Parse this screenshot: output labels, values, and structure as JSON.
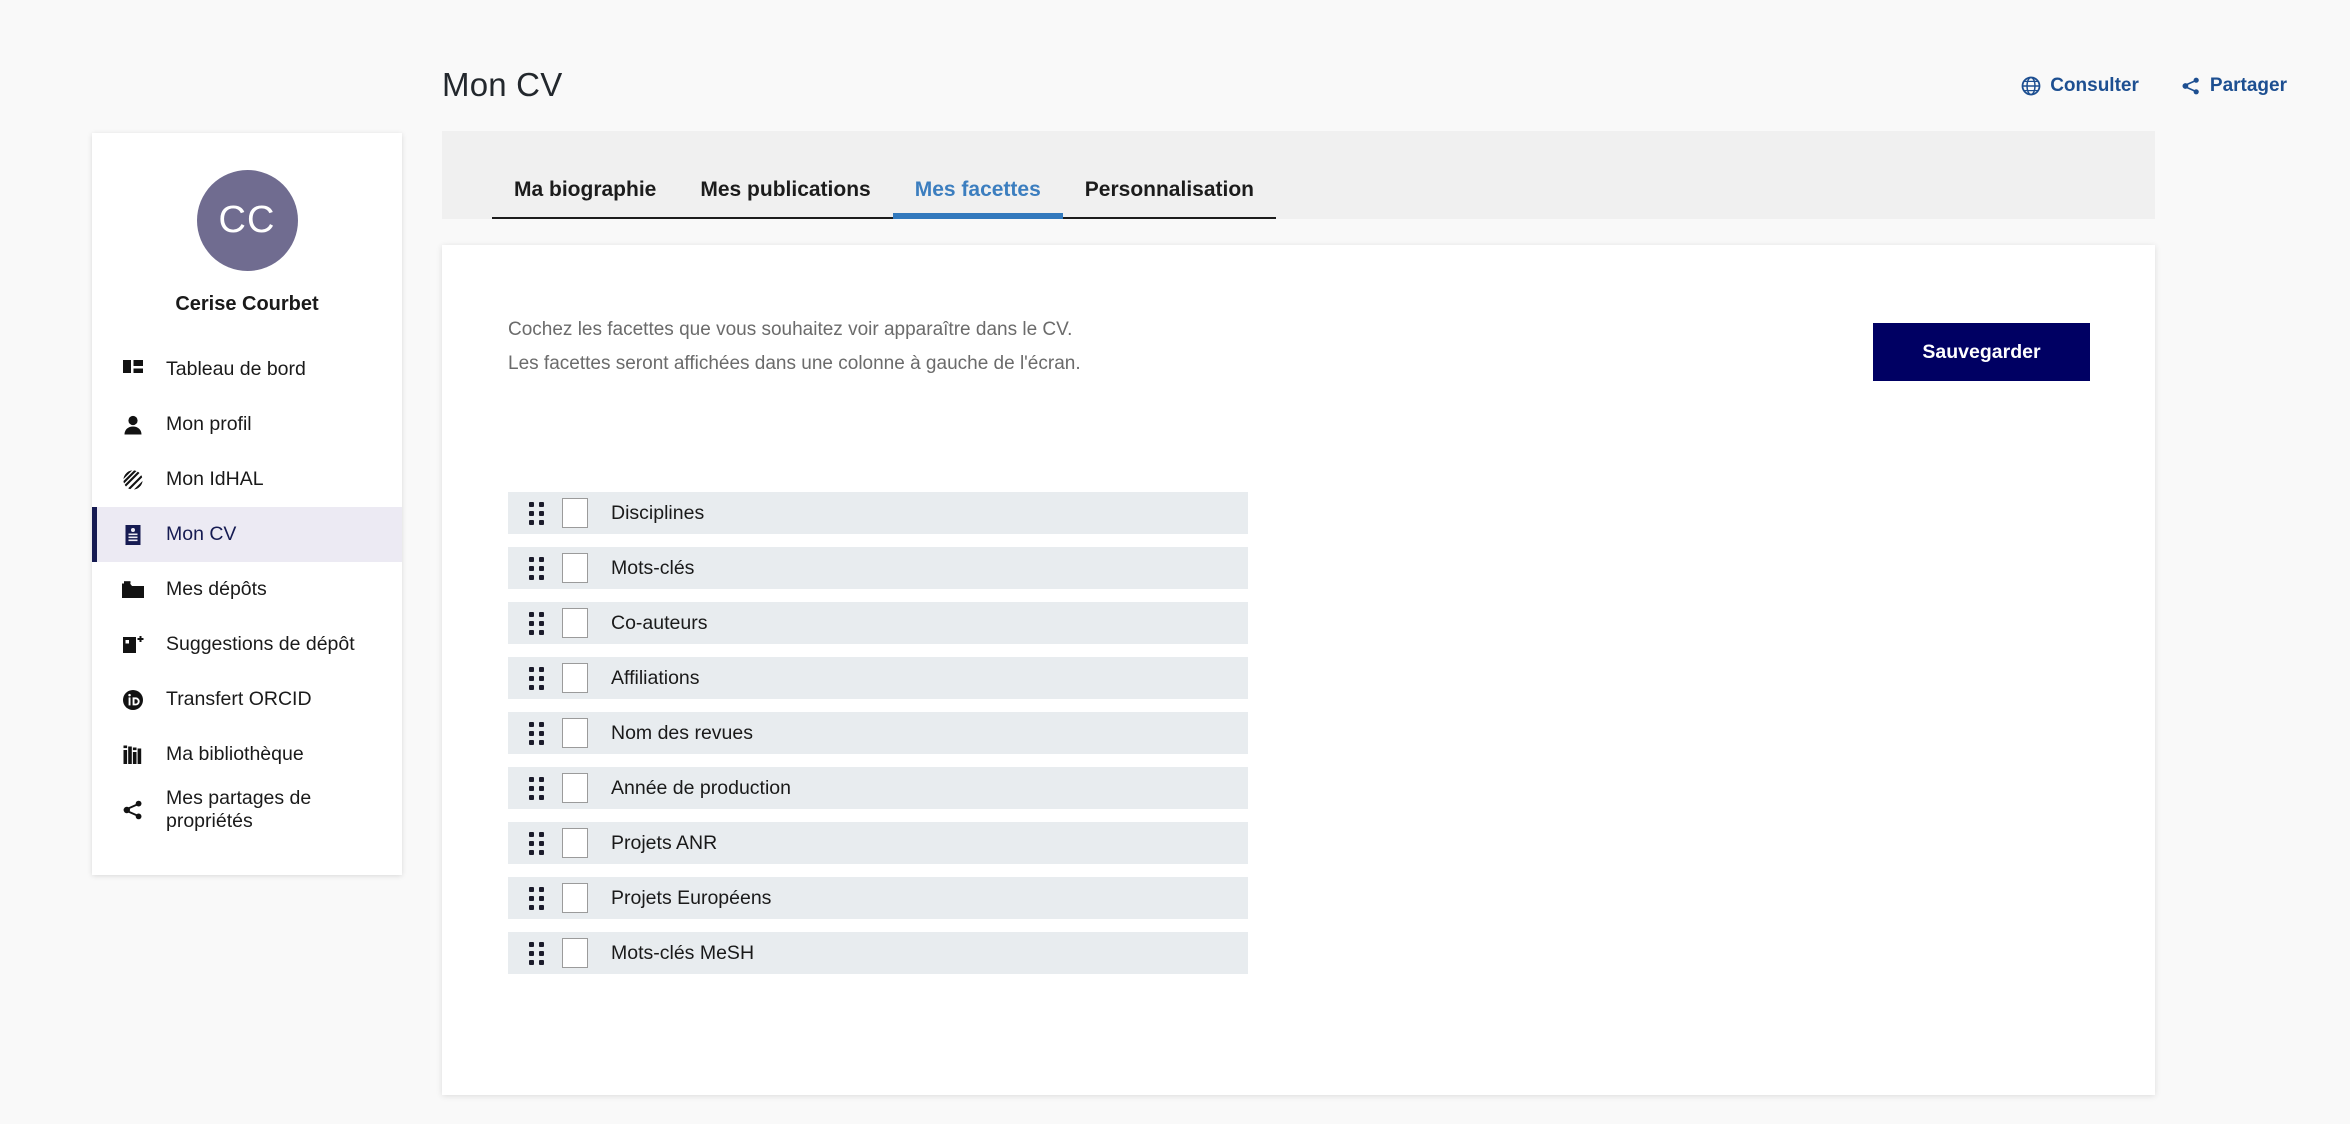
{
  "header": {
    "title": "Mon CV",
    "actions": [
      {
        "label": "Consulter",
        "icon": "globe-icon"
      },
      {
        "label": "Partager",
        "icon": "share-icon"
      }
    ]
  },
  "sidebar": {
    "avatar_initials": "CC",
    "user_name": "Cerise Courbet",
    "items": [
      {
        "label": "Tableau de bord",
        "icon": "dashboard-icon",
        "active": false
      },
      {
        "label": "Mon profil",
        "icon": "user-icon",
        "active": false
      },
      {
        "label": "Mon IdHAL",
        "icon": "hal-logo-icon",
        "active": false
      },
      {
        "label": "Mon CV",
        "icon": "cv-document-icon",
        "active": true
      },
      {
        "label": "Mes dépôts",
        "icon": "folder-icon",
        "active": false
      },
      {
        "label": "Suggestions de dépôt",
        "icon": "document-plus-icon",
        "active": false
      },
      {
        "label": "Transfert ORCID",
        "icon": "orcid-icon",
        "active": false
      },
      {
        "label": "Ma bibliothèque",
        "icon": "books-icon",
        "active": false
      },
      {
        "label": "Mes partages de propriétés",
        "icon": "share-icon",
        "active": false
      }
    ]
  },
  "tabs": [
    {
      "label": "Ma biographie",
      "active": false
    },
    {
      "label": "Mes publications",
      "active": false
    },
    {
      "label": "Mes facettes",
      "active": true
    },
    {
      "label": "Personnalisation",
      "active": false
    }
  ],
  "main": {
    "intro_line1": "Cochez les facettes que vous souhaitez voir apparaître dans le CV.",
    "intro_line2": "Les facettes seront affichées dans une colonne à gauche de l'écran.",
    "save_label": "Sauvegarder",
    "facets": [
      {
        "label": "Disciplines",
        "checked": false
      },
      {
        "label": "Mots-clés",
        "checked": false
      },
      {
        "label": "Co-auteurs",
        "checked": false
      },
      {
        "label": "Affiliations",
        "checked": false
      },
      {
        "label": "Nom des revues",
        "checked": false
      },
      {
        "label": "Année de production",
        "checked": false
      },
      {
        "label": "Projets ANR",
        "checked": false
      },
      {
        "label": "Projets Européens",
        "checked": false
      },
      {
        "label": "Mots-clés MeSH",
        "checked": false
      }
    ]
  },
  "colors": {
    "page_background": "#f9f9f9",
    "accent_blue": "#1d4f91",
    "active_tab_blue": "#3279bd",
    "save_button_navy": "#000063",
    "avatar_purple": "#706c90",
    "facet_row_background": "#e8ecef",
    "active_nav_background": "#eceaf3"
  }
}
